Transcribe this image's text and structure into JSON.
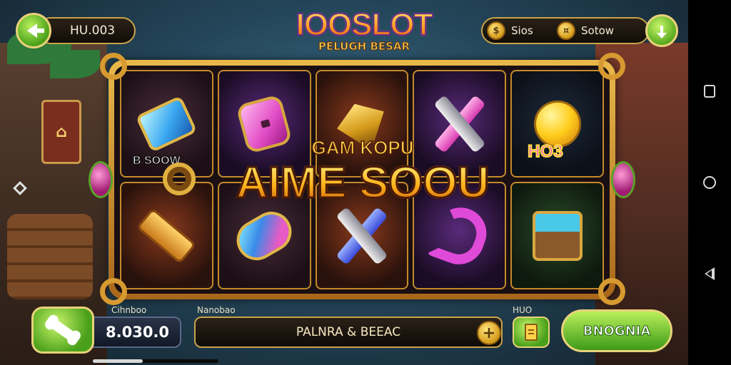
{
  "header": {
    "id_label": "HU.003",
    "logo_title": "IOOSLOT",
    "logo_subtitle": "PELUGH BESAR",
    "stats": [
      {
        "icon": "coin-icon",
        "label": "Sios"
      },
      {
        "icon": "coin-icon",
        "label": "Sotow"
      }
    ]
  },
  "reels": {
    "row1": [
      {
        "symbol": "crystal",
        "label": "B SOOW"
      },
      {
        "symbol": "whistle",
        "label": ""
      },
      {
        "symbol": "spinning-top",
        "label": ""
      },
      {
        "symbol": "crossed-bars",
        "label": ""
      },
      {
        "symbol": "golden-orb",
        "label": "HO3"
      }
    ],
    "row2": [
      {
        "symbol": "scroll",
        "label": ""
      },
      {
        "symbol": "candy",
        "label": ""
      },
      {
        "symbol": "crossed-bars-blue",
        "label": ""
      },
      {
        "symbol": "hook",
        "label": ""
      },
      {
        "symbol": "treasure-chest",
        "label": ""
      }
    ]
  },
  "overlay": {
    "subtitle": "GAM KOPU",
    "title": "AIME SOOU"
  },
  "footer": {
    "balance_label": "Cihnboo",
    "balance_value": "8.030.0",
    "bet_label": "Nanobao",
    "bet_value": "PALNRA & BEEAC",
    "auto_label": "HUO",
    "spin_label": "BNOGNIA",
    "scroll_progress": 0.4
  },
  "colors": {
    "accent_green": "#4aa01a",
    "gold": "#e0b84a",
    "panel_dark": "#110d08"
  }
}
